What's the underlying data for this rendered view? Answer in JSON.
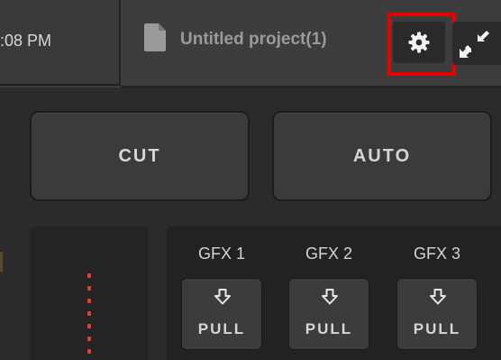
{
  "topbar": {
    "clock_text": ":08 PM",
    "project_name": "Untitled project(1)",
    "icons": {
      "file": "file-icon",
      "settings": "gear-icon",
      "collapse": "collapse-arrows-icon"
    },
    "highlight_color": "#e80000"
  },
  "transitions": {
    "cut_label": "CUT",
    "auto_label": "AUTO"
  },
  "gfx": [
    {
      "label": "GFX 1",
      "pull_label": "PULL",
      "icon": "arrow-down-outline-icon"
    },
    {
      "label": "GFX 2",
      "pull_label": "PULL",
      "icon": "arrow-down-outline-icon"
    },
    {
      "label": "GFX 3",
      "pull_label": "PULL",
      "icon": "arrow-down-outline-icon"
    }
  ],
  "colors": {
    "indicator_dots": "#e0402a",
    "text_light": "#d6d6d6",
    "text_muted": "#9a9a9a"
  }
}
